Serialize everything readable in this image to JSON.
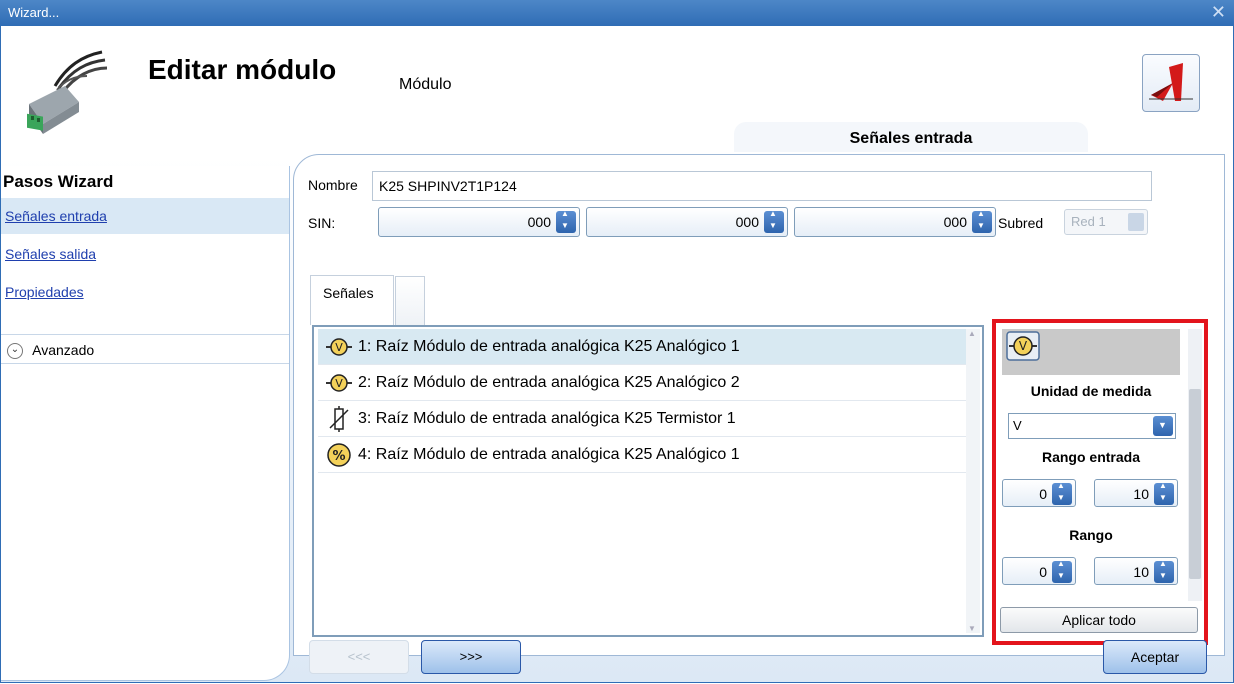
{
  "window": {
    "title": "Wizard...",
    "close_glyph": "✕"
  },
  "header": {
    "title": "Editar módulo",
    "subtitle": "Módulo",
    "active_tab": "Señales entrada"
  },
  "sidebar": {
    "title": "Pasos Wizard",
    "steps": [
      {
        "label": "Señales entrada",
        "active": true
      },
      {
        "label": "Señales salida",
        "active": false
      },
      {
        "label": "Propiedades",
        "active": false
      }
    ],
    "advanced_label": "Avanzado"
  },
  "form": {
    "name_label": "Nombre",
    "name_value": "K25 SHPINV2T1P124",
    "sin_label": "SIN:",
    "sin_values": [
      "000",
      "000",
      "000"
    ],
    "subnet_label": "Subred",
    "subnet_value": "Red 1"
  },
  "signals_tab": {
    "label": "Señales"
  },
  "signals": [
    {
      "icon": "voltage-icon",
      "text": "1: Raíz Módulo de entrada analógica K25 Analógico 1",
      "selected": true
    },
    {
      "icon": "voltage-icon",
      "text": "2: Raíz Módulo de entrada analógica K25 Analógico 2",
      "selected": false
    },
    {
      "icon": "thermistor-icon",
      "text": "3: Raíz Módulo de entrada analógica K25 Termistor 1",
      "selected": false
    },
    {
      "icon": "percent-icon",
      "text": "4: Raíz Módulo de entrada analógica K25 Analógico 1",
      "selected": false
    }
  ],
  "properties": {
    "icon": "voltage-icon",
    "unit_title": "Unidad de medida",
    "unit_value": "V",
    "input_range_title": "Rango entrada",
    "input_range": [
      "0",
      "10"
    ],
    "range_title": "Rango",
    "range": [
      "0",
      "10"
    ],
    "apply_label": "Aplicar todo"
  },
  "footer": {
    "prev_label": "<<<",
    "next_label": ">>>",
    "accept_label": "Aceptar"
  },
  "colors": {
    "highlight_border": "#e3141c",
    "accent": "#2e64ad",
    "selection": "#d8e9f2"
  }
}
